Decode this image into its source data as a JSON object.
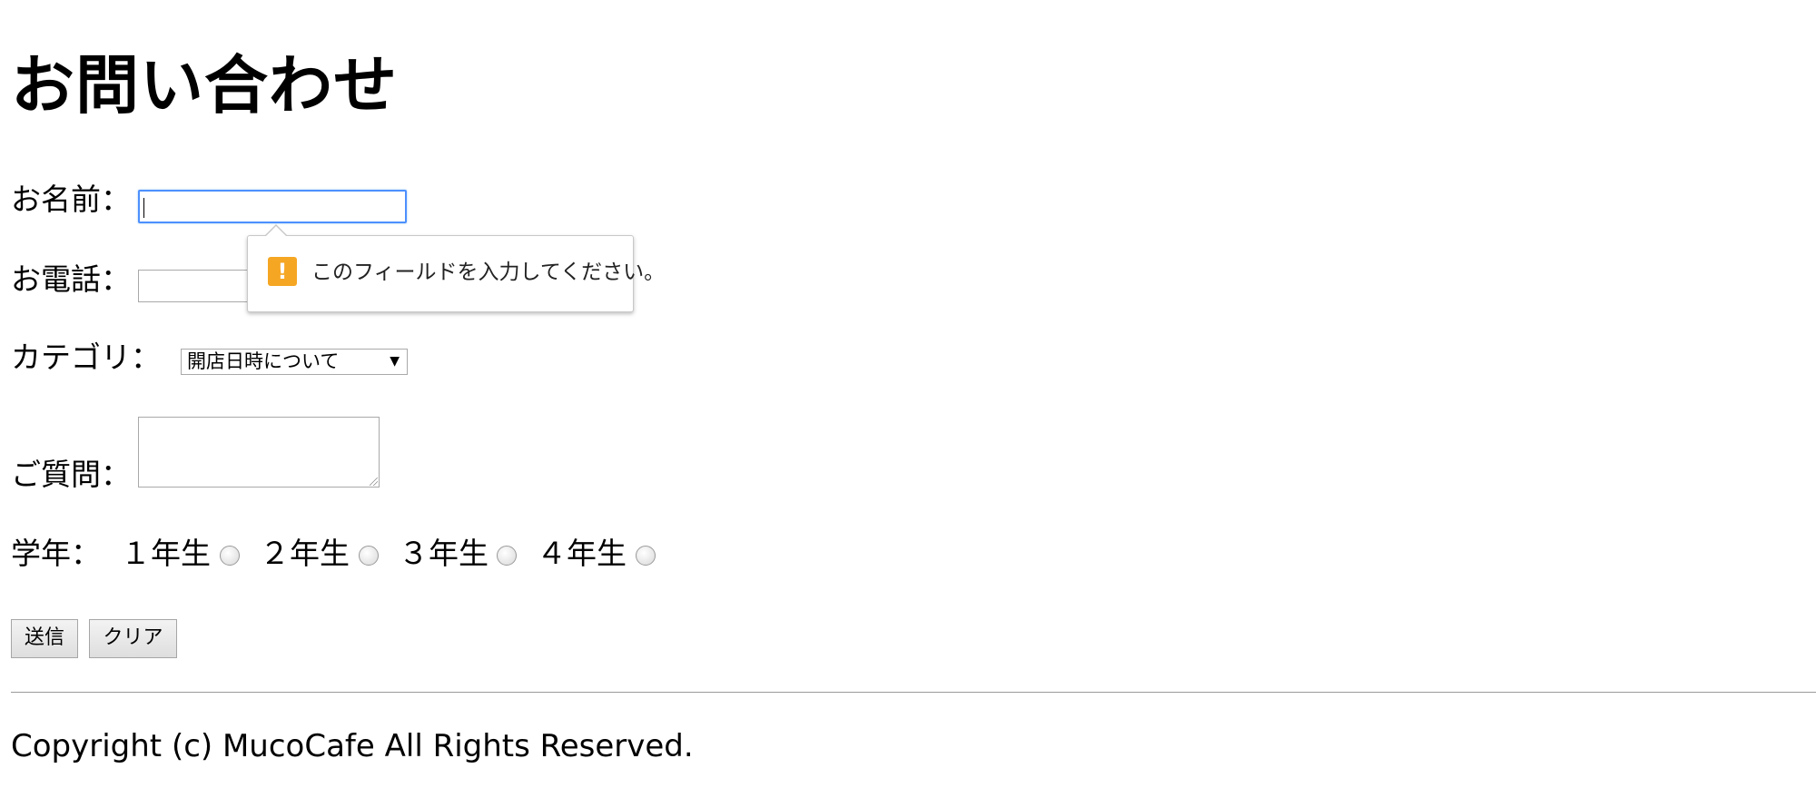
{
  "page": {
    "title": "お問い合わせ"
  },
  "form": {
    "name_label": "お名前：",
    "name_value": "",
    "phone_label": "お電話：",
    "phone_value": "",
    "category_label": "カテゴリ：",
    "category_selected": "開店日時について",
    "question_label": "ご質問：",
    "question_value": "",
    "grade_label": "学年：",
    "grade_options": [
      {
        "label": "１年生",
        "checked": false
      },
      {
        "label": "２年生",
        "checked": false
      },
      {
        "label": "３年生",
        "checked": false
      },
      {
        "label": "４年生",
        "checked": false
      }
    ],
    "submit_label": "送信",
    "clear_label": "クリア"
  },
  "validation": {
    "message": "このフィールドを入力してください。",
    "icon": "warning-icon",
    "icon_color": "#f5a623"
  },
  "footer": {
    "copyright": "Copyright (c) MucoCafe All Rights Reserved."
  },
  "colors": {
    "focus_border": "#4d90fe"
  }
}
